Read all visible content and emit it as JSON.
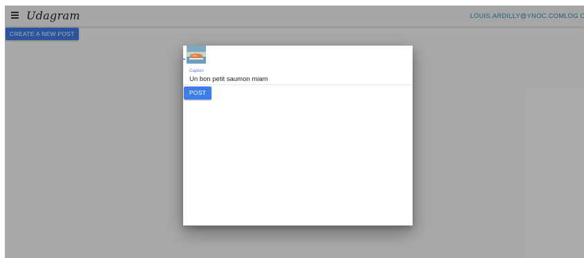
{
  "toolbar": {
    "menu_icon": "menu-icon",
    "brand": "Udagram",
    "user_email": "LOUIS.ARDILLY@YNOC.COM",
    "logout_label": "LOG OUT"
  },
  "main": {
    "create_post_label": "CREATE A NEW POST"
  },
  "dialog": {
    "image_preview": "uploaded-photo-thumbnail",
    "caption_label": "Caption",
    "caption_value": "Un bon petit saumon miam",
    "post_label": "POST"
  },
  "colors": {
    "accent": "#3f7de9",
    "link": "#2f8cb5",
    "backdrop": "rgba(0,0,0,0.32)"
  }
}
